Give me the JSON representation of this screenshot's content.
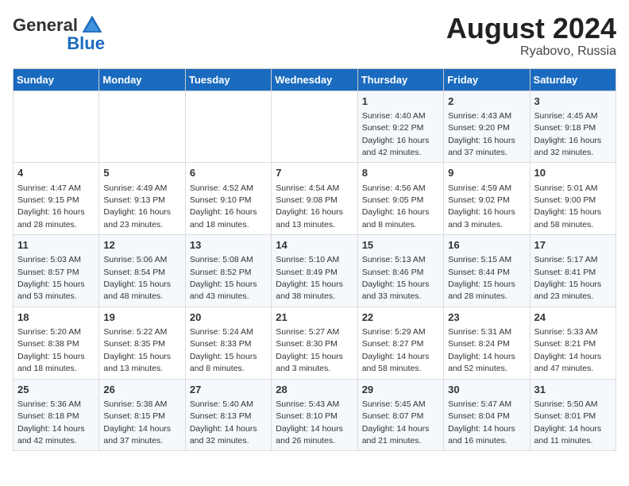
{
  "header": {
    "logo_general": "General",
    "logo_blue": "Blue",
    "month_year": "August 2024",
    "location": "Ryabovo, Russia"
  },
  "weekdays": [
    "Sunday",
    "Monday",
    "Tuesday",
    "Wednesday",
    "Thursday",
    "Friday",
    "Saturday"
  ],
  "weeks": [
    [
      {
        "day": "",
        "info": ""
      },
      {
        "day": "",
        "info": ""
      },
      {
        "day": "",
        "info": ""
      },
      {
        "day": "",
        "info": ""
      },
      {
        "day": "1",
        "info": "Sunrise: 4:40 AM\nSunset: 9:22 PM\nDaylight: 16 hours\nand 42 minutes."
      },
      {
        "day": "2",
        "info": "Sunrise: 4:43 AM\nSunset: 9:20 PM\nDaylight: 16 hours\nand 37 minutes."
      },
      {
        "day": "3",
        "info": "Sunrise: 4:45 AM\nSunset: 9:18 PM\nDaylight: 16 hours\nand 32 minutes."
      }
    ],
    [
      {
        "day": "4",
        "info": "Sunrise: 4:47 AM\nSunset: 9:15 PM\nDaylight: 16 hours\nand 28 minutes."
      },
      {
        "day": "5",
        "info": "Sunrise: 4:49 AM\nSunset: 9:13 PM\nDaylight: 16 hours\nand 23 minutes."
      },
      {
        "day": "6",
        "info": "Sunrise: 4:52 AM\nSunset: 9:10 PM\nDaylight: 16 hours\nand 18 minutes."
      },
      {
        "day": "7",
        "info": "Sunrise: 4:54 AM\nSunset: 9:08 PM\nDaylight: 16 hours\nand 13 minutes."
      },
      {
        "day": "8",
        "info": "Sunrise: 4:56 AM\nSunset: 9:05 PM\nDaylight: 16 hours\nand 8 minutes."
      },
      {
        "day": "9",
        "info": "Sunrise: 4:59 AM\nSunset: 9:02 PM\nDaylight: 16 hours\nand 3 minutes."
      },
      {
        "day": "10",
        "info": "Sunrise: 5:01 AM\nSunset: 9:00 PM\nDaylight: 15 hours\nand 58 minutes."
      }
    ],
    [
      {
        "day": "11",
        "info": "Sunrise: 5:03 AM\nSunset: 8:57 PM\nDaylight: 15 hours\nand 53 minutes."
      },
      {
        "day": "12",
        "info": "Sunrise: 5:06 AM\nSunset: 8:54 PM\nDaylight: 15 hours\nand 48 minutes."
      },
      {
        "day": "13",
        "info": "Sunrise: 5:08 AM\nSunset: 8:52 PM\nDaylight: 15 hours\nand 43 minutes."
      },
      {
        "day": "14",
        "info": "Sunrise: 5:10 AM\nSunset: 8:49 PM\nDaylight: 15 hours\nand 38 minutes."
      },
      {
        "day": "15",
        "info": "Sunrise: 5:13 AM\nSunset: 8:46 PM\nDaylight: 15 hours\nand 33 minutes."
      },
      {
        "day": "16",
        "info": "Sunrise: 5:15 AM\nSunset: 8:44 PM\nDaylight: 15 hours\nand 28 minutes."
      },
      {
        "day": "17",
        "info": "Sunrise: 5:17 AM\nSunset: 8:41 PM\nDaylight: 15 hours\nand 23 minutes."
      }
    ],
    [
      {
        "day": "18",
        "info": "Sunrise: 5:20 AM\nSunset: 8:38 PM\nDaylight: 15 hours\nand 18 minutes."
      },
      {
        "day": "19",
        "info": "Sunrise: 5:22 AM\nSunset: 8:35 PM\nDaylight: 15 hours\nand 13 minutes."
      },
      {
        "day": "20",
        "info": "Sunrise: 5:24 AM\nSunset: 8:33 PM\nDaylight: 15 hours\nand 8 minutes."
      },
      {
        "day": "21",
        "info": "Sunrise: 5:27 AM\nSunset: 8:30 PM\nDaylight: 15 hours\nand 3 minutes."
      },
      {
        "day": "22",
        "info": "Sunrise: 5:29 AM\nSunset: 8:27 PM\nDaylight: 14 hours\nand 58 minutes."
      },
      {
        "day": "23",
        "info": "Sunrise: 5:31 AM\nSunset: 8:24 PM\nDaylight: 14 hours\nand 52 minutes."
      },
      {
        "day": "24",
        "info": "Sunrise: 5:33 AM\nSunset: 8:21 PM\nDaylight: 14 hours\nand 47 minutes."
      }
    ],
    [
      {
        "day": "25",
        "info": "Sunrise: 5:36 AM\nSunset: 8:18 PM\nDaylight: 14 hours\nand 42 minutes."
      },
      {
        "day": "26",
        "info": "Sunrise: 5:38 AM\nSunset: 8:15 PM\nDaylight: 14 hours\nand 37 minutes."
      },
      {
        "day": "27",
        "info": "Sunrise: 5:40 AM\nSunset: 8:13 PM\nDaylight: 14 hours\nand 32 minutes."
      },
      {
        "day": "28",
        "info": "Sunrise: 5:43 AM\nSunset: 8:10 PM\nDaylight: 14 hours\nand 26 minutes."
      },
      {
        "day": "29",
        "info": "Sunrise: 5:45 AM\nSunset: 8:07 PM\nDaylight: 14 hours\nand 21 minutes."
      },
      {
        "day": "30",
        "info": "Sunrise: 5:47 AM\nSunset: 8:04 PM\nDaylight: 14 hours\nand 16 minutes."
      },
      {
        "day": "31",
        "info": "Sunrise: 5:50 AM\nSunset: 8:01 PM\nDaylight: 14 hours\nand 11 minutes."
      }
    ]
  ]
}
